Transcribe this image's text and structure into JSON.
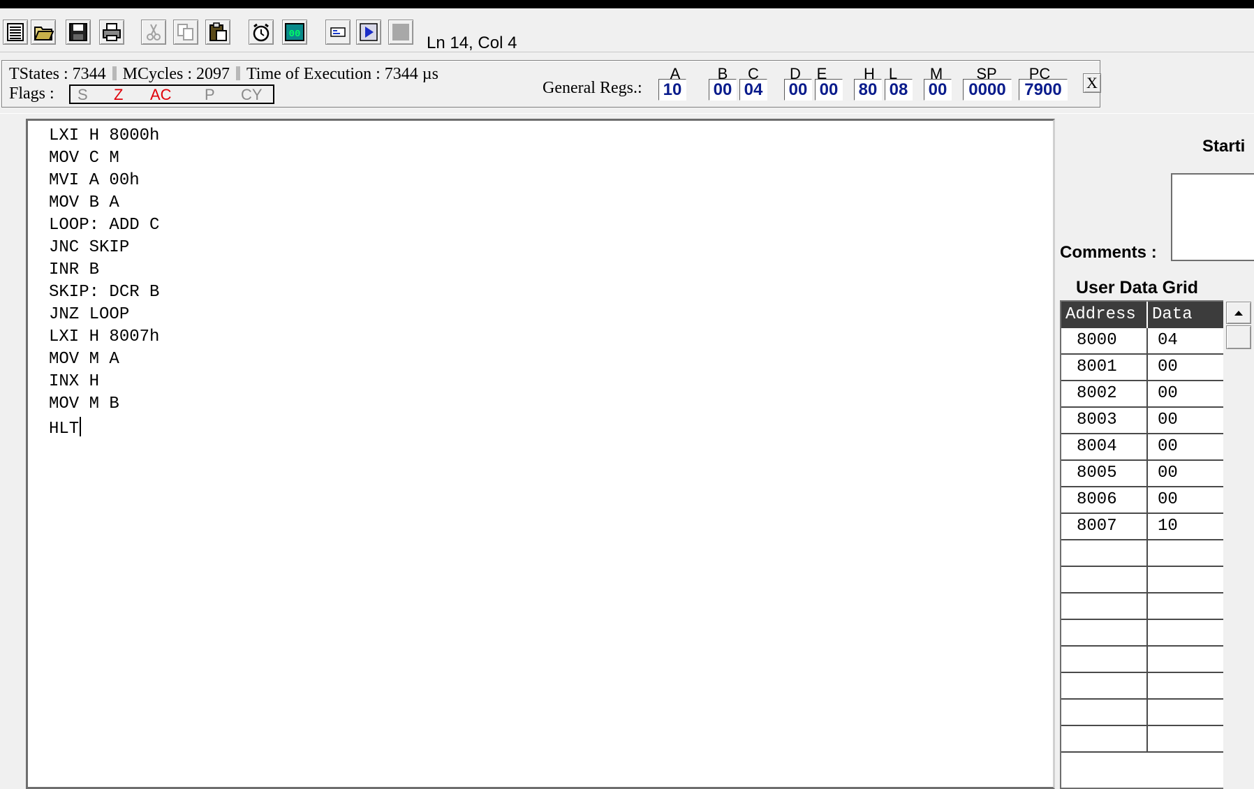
{
  "toolbar": {
    "buttons": [
      {
        "name": "new-document-button",
        "icon": "lines-page-icon"
      },
      {
        "name": "open-folder-button",
        "icon": "folder-icon"
      },
      {
        "name": "save-button",
        "icon": "floppy-disk-icon"
      },
      {
        "name": "print-button",
        "icon": "printer-icon"
      },
      {
        "name": "cut-button",
        "icon": "scissors-icon"
      },
      {
        "name": "copy-button",
        "icon": "copy-icon"
      },
      {
        "name": "paste-button",
        "icon": "clipboard-icon"
      },
      {
        "name": "timer-button",
        "icon": "alarm-clock-icon"
      },
      {
        "name": "hex-display-button",
        "icon": "hex-display-icon"
      },
      {
        "name": "step-button",
        "icon": "step-icon"
      },
      {
        "name": "run-button",
        "icon": "play-icon"
      },
      {
        "name": "stop-button",
        "icon": "stop-icon"
      }
    ],
    "cursor_position": "Ln 14, Col 4"
  },
  "stats": {
    "tstates": "TStates : 7344",
    "mcycles": "MCycles : 2097",
    "execution_time": "Time of Execution : 7344 µs",
    "flags_label": "Flags :",
    "general_regs_label": "General Regs.:",
    "close_label": "X"
  },
  "flags": [
    {
      "name": "S",
      "set": false
    },
    {
      "name": "Z",
      "set": true
    },
    {
      "name": "AC",
      "set": true
    },
    {
      "name": "P",
      "set": false
    },
    {
      "name": "CY",
      "set": false
    }
  ],
  "registers": [
    {
      "name": "A",
      "value": "10"
    },
    {
      "name": "B",
      "value": "00"
    },
    {
      "name": "C",
      "value": "04"
    },
    {
      "name": "D",
      "value": "00"
    },
    {
      "name": "E",
      "value": "00"
    },
    {
      "name": "H",
      "value": "80"
    },
    {
      "name": "L",
      "value": "08"
    },
    {
      "name": "M",
      "value": "00"
    },
    {
      "name": "SP",
      "value": "0000"
    },
    {
      "name": "PC",
      "value": "7900"
    }
  ],
  "editor": {
    "lines": [
      "LXI H 8000h",
      "MOV C M",
      "MVI A 00h",
      "MOV B A",
      "LOOP: ADD C",
      "JNC SKIP",
      "INR B",
      "SKIP: DCR B",
      "JNZ LOOP",
      "LXI H 8007h",
      "MOV M A",
      "INX H",
      "MOV M B",
      "HLT"
    ]
  },
  "side_panel": {
    "starting_label": "Starti",
    "comments_label": "Comments :",
    "grid_title": "User Data Grid",
    "columns": [
      "Address",
      "Data"
    ],
    "rows": [
      [
        "8000",
        "04"
      ],
      [
        "8001",
        "00"
      ],
      [
        "8002",
        "00"
      ],
      [
        "8003",
        "00"
      ],
      [
        "8004",
        "00"
      ],
      [
        "8005",
        "00"
      ],
      [
        "8006",
        "00"
      ],
      [
        "8007",
        "10"
      ],
      [
        "",
        ""
      ],
      [
        "",
        ""
      ],
      [
        "",
        ""
      ],
      [
        "",
        ""
      ],
      [
        "",
        ""
      ],
      [
        "",
        ""
      ],
      [
        "",
        ""
      ],
      [
        "",
        ""
      ]
    ]
  },
  "colors": {
    "flag_set": "#e0000a",
    "flag_clear": "#8a8a8a",
    "register_value": "#0a1c8c",
    "grid_header_bg": "#3c3c3c"
  }
}
